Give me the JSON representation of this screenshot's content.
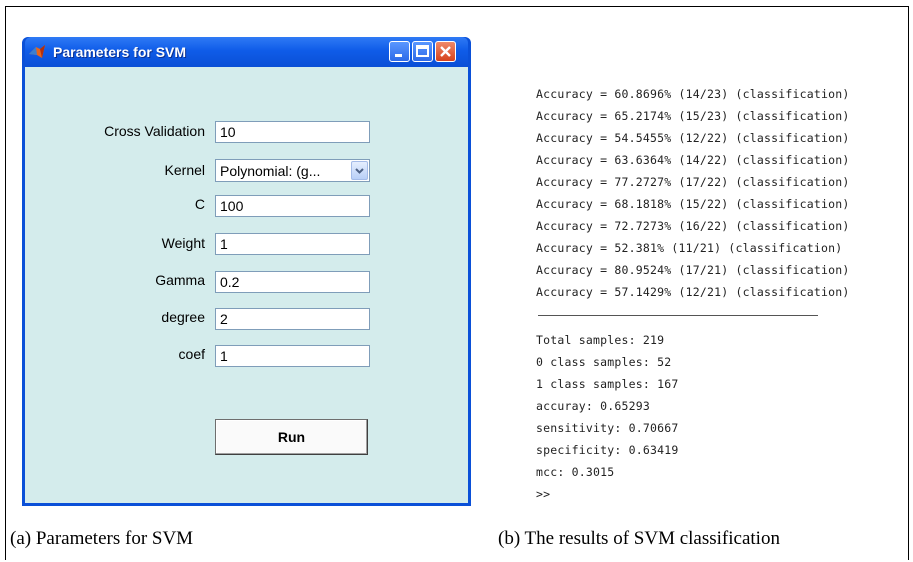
{
  "window": {
    "title": "Parameters for SVM",
    "app_icon": "matlab-icon",
    "controls": [
      "minimize-icon",
      "maximize-icon",
      "close-icon"
    ]
  },
  "form": {
    "cross_validation": {
      "label": "Cross Validation",
      "value": "10"
    },
    "kernel": {
      "label": "Kernel",
      "value": "Polynomial: (g..."
    },
    "c": {
      "label": "C",
      "value": "100"
    },
    "weight": {
      "label": "Weight",
      "value": "1"
    },
    "gamma": {
      "label": "Gamma",
      "value": "0.2"
    },
    "degree": {
      "label": "degree",
      "value": "2"
    },
    "coef": {
      "label": "coef",
      "value": "1"
    },
    "run_label": "Run"
  },
  "console": {
    "accuracy_lines": [
      "Accuracy = 60.8696% (14/23) (classification)",
      "Accuracy = 65.2174% (15/23) (classification)",
      "Accuracy = 54.5455% (12/22) (classification)",
      "Accuracy = 63.6364% (14/22) (classification)",
      "Accuracy = 77.2727% (17/22) (classification)",
      "Accuracy = 68.1818% (15/22) (classification)",
      "Accuracy = 72.7273% (16/22) (classification)",
      "Accuracy = 52.381% (11/21) (classification)",
      "Accuracy = 80.9524% (17/21) (classification)",
      "Accuracy = 57.1429% (12/21) (classification)"
    ],
    "summary_lines": [
      "Total samples: 219",
      "0 class samples: 52",
      "1 class samples: 167",
      "accuray: 0.65293",
      "sensitivity: 0.70667",
      "specificity: 0.63419",
      "mcc: 0.3015",
      ">>"
    ]
  },
  "captions": {
    "a": "(a) Parameters for SVM",
    "b": "(b) The results of SVM classification"
  },
  "colors": {
    "titlebar": "#0f5ce8",
    "client_bg": "#d4ecec",
    "close_button": "#d6421c"
  }
}
